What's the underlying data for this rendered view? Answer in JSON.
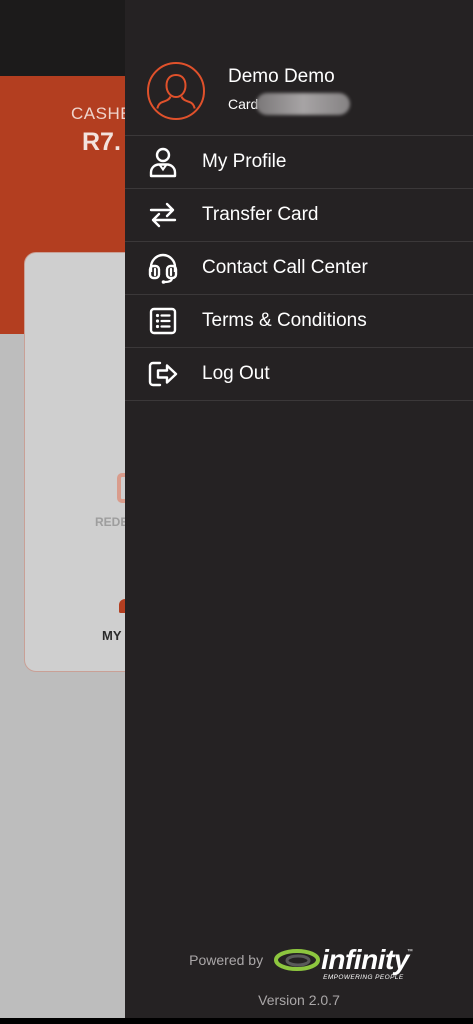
{
  "background_app": {
    "balance_label": "CASHE",
    "balance_value": "R7.",
    "redeem_label": "REDE",
    "my_label": "MY"
  },
  "drawer": {
    "user": {
      "name": "Demo Demo",
      "card_label": "Card"
    },
    "menu": [
      {
        "label": "My Profile",
        "icon": "person-icon"
      },
      {
        "label": "Transfer Card",
        "icon": "transfer-arrows-icon"
      },
      {
        "label": "Contact Call Center",
        "icon": "headset-icon"
      },
      {
        "label": "Terms & Conditions",
        "icon": "list-document-icon"
      },
      {
        "label": "Log Out",
        "icon": "logout-icon"
      }
    ],
    "footer": {
      "powered_by": "Powered by",
      "logo_text": "infinity",
      "logo_tm": "™",
      "logo_tagline": "EMPOWERING PEOPLE",
      "version": "Version 2.0.7"
    }
  },
  "colors": {
    "accent": "#e0512b",
    "header_bg": "#b33e20",
    "drawer_bg": "#252223",
    "logo_green": "#8dc63f"
  }
}
